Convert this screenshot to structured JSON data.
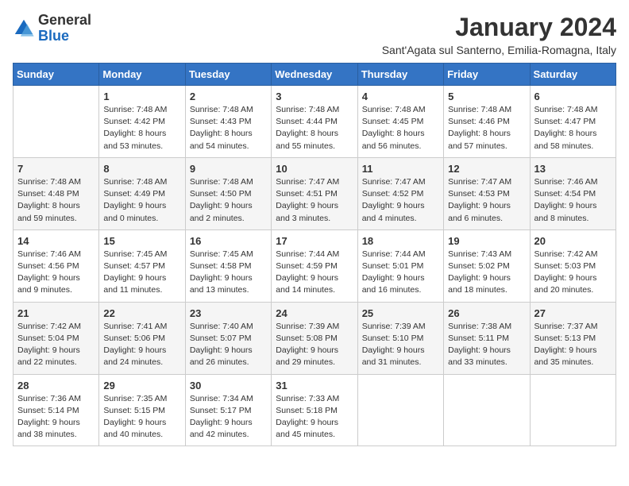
{
  "header": {
    "logo_general": "General",
    "logo_blue": "Blue",
    "title": "January 2024",
    "subtitle": "Sant'Agata sul Santerno, Emilia-Romagna, Italy"
  },
  "weekdays": [
    "Sunday",
    "Monday",
    "Tuesday",
    "Wednesday",
    "Thursday",
    "Friday",
    "Saturday"
  ],
  "weeks": [
    [
      {
        "day": "",
        "info": ""
      },
      {
        "day": "1",
        "info": "Sunrise: 7:48 AM\nSunset: 4:42 PM\nDaylight: 8 hours\nand 53 minutes."
      },
      {
        "day": "2",
        "info": "Sunrise: 7:48 AM\nSunset: 4:43 PM\nDaylight: 8 hours\nand 54 minutes."
      },
      {
        "day": "3",
        "info": "Sunrise: 7:48 AM\nSunset: 4:44 PM\nDaylight: 8 hours\nand 55 minutes."
      },
      {
        "day": "4",
        "info": "Sunrise: 7:48 AM\nSunset: 4:45 PM\nDaylight: 8 hours\nand 56 minutes."
      },
      {
        "day": "5",
        "info": "Sunrise: 7:48 AM\nSunset: 4:46 PM\nDaylight: 8 hours\nand 57 minutes."
      },
      {
        "day": "6",
        "info": "Sunrise: 7:48 AM\nSunset: 4:47 PM\nDaylight: 8 hours\nand 58 minutes."
      }
    ],
    [
      {
        "day": "7",
        "info": "Sunrise: 7:48 AM\nSunset: 4:48 PM\nDaylight: 8 hours\nand 59 minutes."
      },
      {
        "day": "8",
        "info": "Sunrise: 7:48 AM\nSunset: 4:49 PM\nDaylight: 9 hours\nand 0 minutes."
      },
      {
        "day": "9",
        "info": "Sunrise: 7:48 AM\nSunset: 4:50 PM\nDaylight: 9 hours\nand 2 minutes."
      },
      {
        "day": "10",
        "info": "Sunrise: 7:47 AM\nSunset: 4:51 PM\nDaylight: 9 hours\nand 3 minutes."
      },
      {
        "day": "11",
        "info": "Sunrise: 7:47 AM\nSunset: 4:52 PM\nDaylight: 9 hours\nand 4 minutes."
      },
      {
        "day": "12",
        "info": "Sunrise: 7:47 AM\nSunset: 4:53 PM\nDaylight: 9 hours\nand 6 minutes."
      },
      {
        "day": "13",
        "info": "Sunrise: 7:46 AM\nSunset: 4:54 PM\nDaylight: 9 hours\nand 8 minutes."
      }
    ],
    [
      {
        "day": "14",
        "info": "Sunrise: 7:46 AM\nSunset: 4:56 PM\nDaylight: 9 hours\nand 9 minutes."
      },
      {
        "day": "15",
        "info": "Sunrise: 7:45 AM\nSunset: 4:57 PM\nDaylight: 9 hours\nand 11 minutes."
      },
      {
        "day": "16",
        "info": "Sunrise: 7:45 AM\nSunset: 4:58 PM\nDaylight: 9 hours\nand 13 minutes."
      },
      {
        "day": "17",
        "info": "Sunrise: 7:44 AM\nSunset: 4:59 PM\nDaylight: 9 hours\nand 14 minutes."
      },
      {
        "day": "18",
        "info": "Sunrise: 7:44 AM\nSunset: 5:01 PM\nDaylight: 9 hours\nand 16 minutes."
      },
      {
        "day": "19",
        "info": "Sunrise: 7:43 AM\nSunset: 5:02 PM\nDaylight: 9 hours\nand 18 minutes."
      },
      {
        "day": "20",
        "info": "Sunrise: 7:42 AM\nSunset: 5:03 PM\nDaylight: 9 hours\nand 20 minutes."
      }
    ],
    [
      {
        "day": "21",
        "info": "Sunrise: 7:42 AM\nSunset: 5:04 PM\nDaylight: 9 hours\nand 22 minutes."
      },
      {
        "day": "22",
        "info": "Sunrise: 7:41 AM\nSunset: 5:06 PM\nDaylight: 9 hours\nand 24 minutes."
      },
      {
        "day": "23",
        "info": "Sunrise: 7:40 AM\nSunset: 5:07 PM\nDaylight: 9 hours\nand 26 minutes."
      },
      {
        "day": "24",
        "info": "Sunrise: 7:39 AM\nSunset: 5:08 PM\nDaylight: 9 hours\nand 29 minutes."
      },
      {
        "day": "25",
        "info": "Sunrise: 7:39 AM\nSunset: 5:10 PM\nDaylight: 9 hours\nand 31 minutes."
      },
      {
        "day": "26",
        "info": "Sunrise: 7:38 AM\nSunset: 5:11 PM\nDaylight: 9 hours\nand 33 minutes."
      },
      {
        "day": "27",
        "info": "Sunrise: 7:37 AM\nSunset: 5:13 PM\nDaylight: 9 hours\nand 35 minutes."
      }
    ],
    [
      {
        "day": "28",
        "info": "Sunrise: 7:36 AM\nSunset: 5:14 PM\nDaylight: 9 hours\nand 38 minutes."
      },
      {
        "day": "29",
        "info": "Sunrise: 7:35 AM\nSunset: 5:15 PM\nDaylight: 9 hours\nand 40 minutes."
      },
      {
        "day": "30",
        "info": "Sunrise: 7:34 AM\nSunset: 5:17 PM\nDaylight: 9 hours\nand 42 minutes."
      },
      {
        "day": "31",
        "info": "Sunrise: 7:33 AM\nSunset: 5:18 PM\nDaylight: 9 hours\nand 45 minutes."
      },
      {
        "day": "",
        "info": ""
      },
      {
        "day": "",
        "info": ""
      },
      {
        "day": "",
        "info": ""
      }
    ]
  ]
}
